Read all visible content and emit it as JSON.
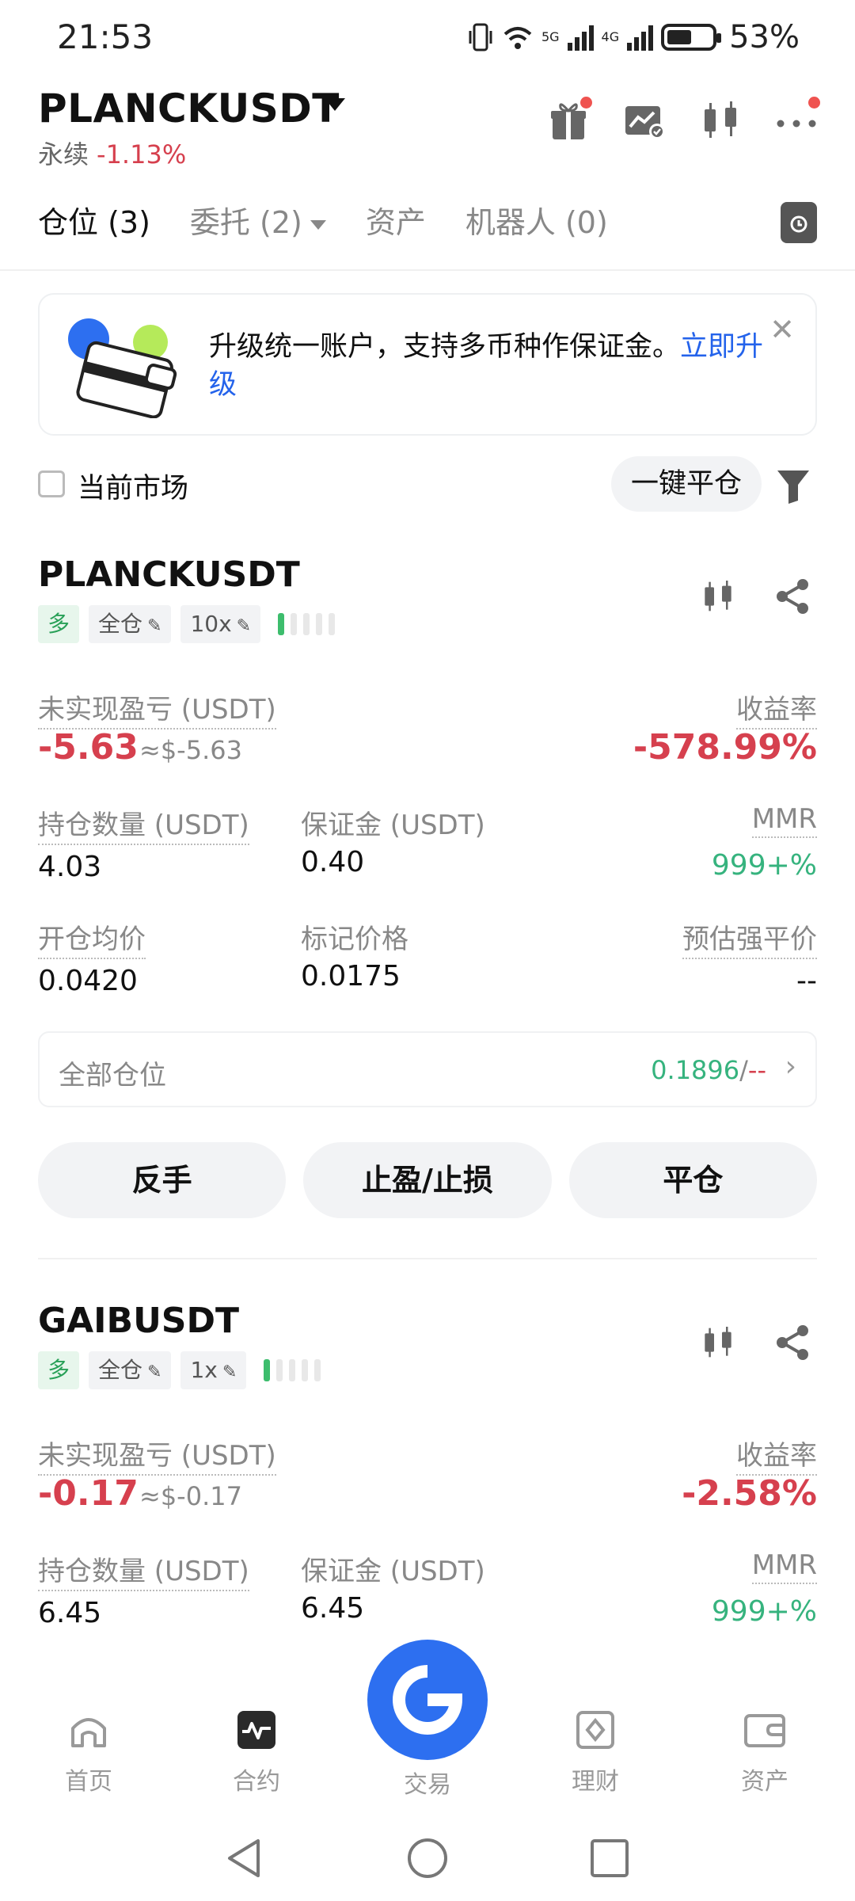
{
  "status_bar": {
    "time": "21:53",
    "network_1": "5G",
    "network_2": "4G",
    "battery": "53%"
  },
  "header": {
    "pair": "PLANCKUSDT",
    "contract_type": "永续",
    "change": "-1.13%",
    "icons": [
      "gift-icon",
      "chart-check-icon",
      "candlestick-icon",
      "more-icon"
    ]
  },
  "tabs": {
    "positions": "仓位 (3)",
    "orders": "委托 (2)",
    "assets": "资产",
    "bots": "机器人 (0)"
  },
  "banner": {
    "text": "升级统一账户，支持多币种作保证金。",
    "link": "立即升级",
    "close": "✕"
  },
  "filter": {
    "current_market": "当前市场",
    "close_all": "一键平仓"
  },
  "positions": [
    {
      "symbol": "PLANCKUSDT",
      "side": "多",
      "margin_mode": "全仓",
      "leverage": "10x",
      "unrealized_pnl_label": "未实现盈亏 (USDT)",
      "unrealized_pnl": "-5.63",
      "unrealized_pnl_usd": "≈$-5.63",
      "roi_label": "收益率",
      "roi": "-578.99%",
      "size_label": "持仓数量 (USDT)",
      "size": "4.03",
      "margin_label": "保证金 (USDT)",
      "margin": "0.40",
      "mmr_label": "MMR",
      "mmr": "999+%",
      "entry_label": "开仓均价",
      "entry": "0.0420",
      "mark_label": "标记价格",
      "mark": "0.0175",
      "liq_label": "预估强平价",
      "liq": "--",
      "all_positions_label": "全部仓位",
      "all_positions_value": "0.1896",
      "all_positions_sep": "/",
      "all_positions_value2": "--",
      "actions": [
        "反手",
        "止盈/止损",
        "平仓"
      ]
    },
    {
      "symbol": "GAIBUSDT",
      "side": "多",
      "margin_mode": "全仓",
      "leverage": "1x",
      "unrealized_pnl_label": "未实现盈亏 (USDT)",
      "unrealized_pnl": "-0.17",
      "unrealized_pnl_usd": "≈$-0.17",
      "roi_label": "收益率",
      "roi": "-2.58%",
      "size_label": "持仓数量 (USDT)",
      "size": "6.45",
      "margin_label": "保证金 (USDT)",
      "margin": "6.45",
      "mmr_label": "MMR",
      "mmr": "999+%"
    }
  ],
  "bottom_nav": {
    "home": "首页",
    "futures": "合约",
    "trade": "交易",
    "earn": "理财",
    "assets": "资产"
  },
  "colors": {
    "red": "#d6404e",
    "green": "#36b37e",
    "link": "#2463eb",
    "fab": "#2d6ff0"
  }
}
